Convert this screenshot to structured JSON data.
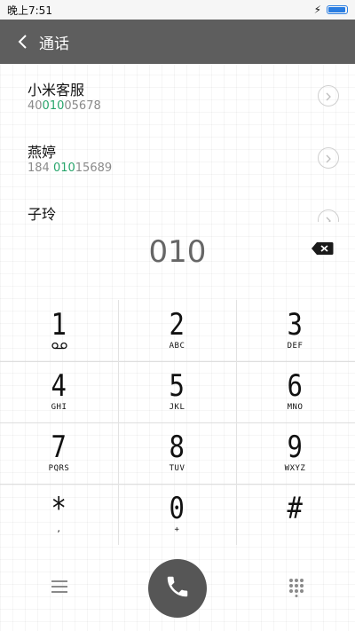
{
  "status_bar": {
    "time": "晚上7:51"
  },
  "app_bar": {
    "title": "通话"
  },
  "contacts": [
    {
      "name": "小米客服",
      "number_pre": "40",
      "number_match": "010",
      "number_post": "05678"
    },
    {
      "name": "燕婷",
      "number_pre": "184 ",
      "number_match": "010",
      "number_post": "15689"
    },
    {
      "name": "子玲",
      "number_pre": "",
      "number_match": "",
      "number_post": ""
    }
  ],
  "dial_display": {
    "digits": "010"
  },
  "keypad": {
    "keys": [
      {
        "digit": "1",
        "letters": ""
      },
      {
        "digit": "2",
        "letters": "ABC"
      },
      {
        "digit": "3",
        "letters": "DEF"
      },
      {
        "digit": "4",
        "letters": "GHI"
      },
      {
        "digit": "5",
        "letters": "JKL"
      },
      {
        "digit": "6",
        "letters": "MNO"
      },
      {
        "digit": "7",
        "letters": "PQRS"
      },
      {
        "digit": "8",
        "letters": "TUV"
      },
      {
        "digit": "9",
        "letters": "WXYZ"
      },
      {
        "digit": "*",
        "letters": ","
      },
      {
        "digit": "0",
        "letters": "+"
      },
      {
        "digit": "#",
        "letters": ""
      }
    ]
  },
  "colors": {
    "app_bar": "#5e5e5e",
    "match_highlight": "#27a56b",
    "call_button": "#565656",
    "battery": "#2a7de1"
  },
  "icons": [
    "back-arrow-icon",
    "charging-icon",
    "battery-icon",
    "chevron-right-icon",
    "backspace-icon",
    "voicemail-icon",
    "menu-icon",
    "phone-icon",
    "dialpad-icon"
  ]
}
